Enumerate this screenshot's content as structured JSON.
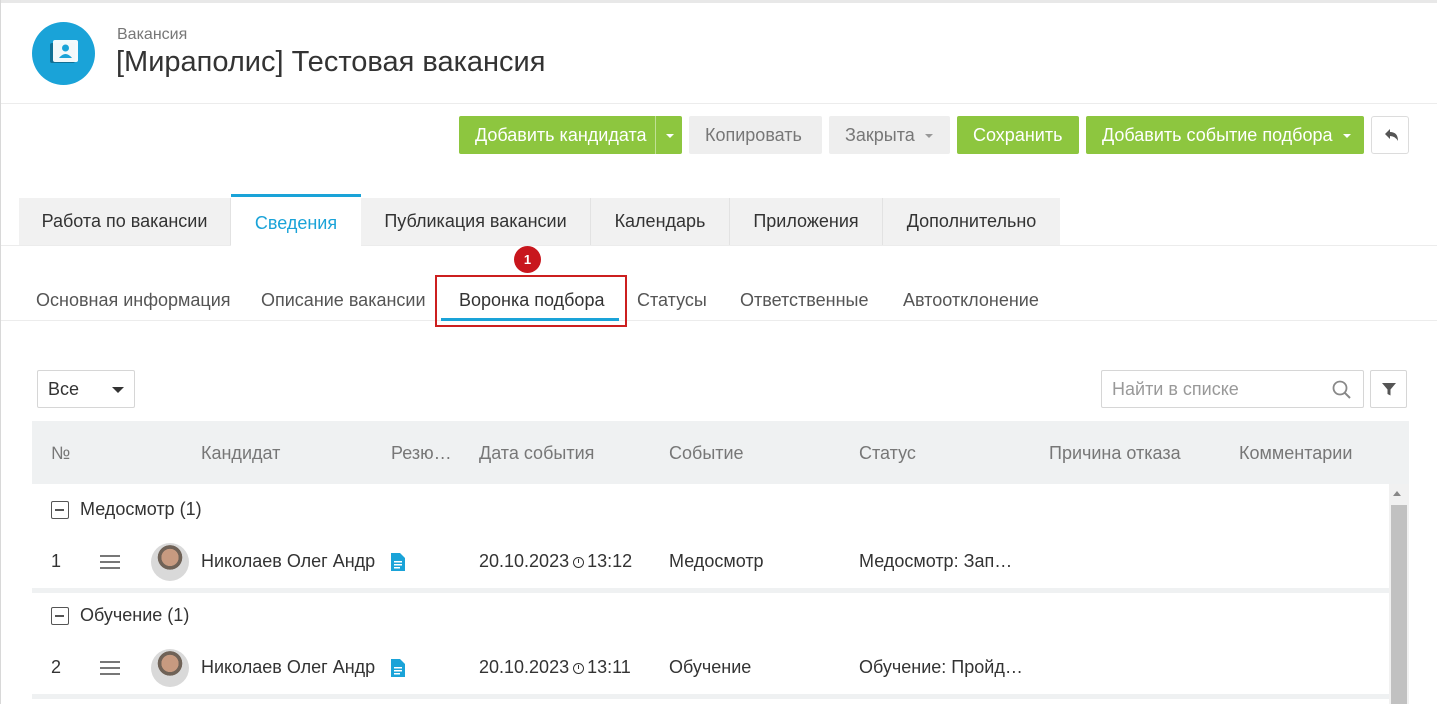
{
  "header": {
    "subtitle": "Вакансия",
    "title": "[Мираполис] Тестовая вакансия"
  },
  "toolbar": {
    "add_candidate": "Добавить кандидата",
    "copy": "Копировать",
    "status": "Закрыта",
    "save": "Сохранить",
    "add_event": "Добавить событие подбора"
  },
  "main_tabs": [
    {
      "label": "Работа по вакансии"
    },
    {
      "label": "Сведения"
    },
    {
      "label": "Публикация вакансии"
    },
    {
      "label": "Календарь"
    },
    {
      "label": "Приложения"
    },
    {
      "label": "Дополнительно"
    }
  ],
  "sub_tabs": [
    {
      "label": "Основная информация"
    },
    {
      "label": "Описание вакансии"
    },
    {
      "label": "Воронка подбора"
    },
    {
      "label": "Статусы"
    },
    {
      "label": "Ответственные"
    },
    {
      "label": "Автоотклонение"
    }
  ],
  "annotation": {
    "marker": "1"
  },
  "filter": {
    "selected": "Все",
    "search_placeholder": "Найти в списке"
  },
  "table": {
    "columns": [
      "№",
      "Кандидат",
      "Резю…",
      "Дата события",
      "Событие",
      "Статус",
      "Причина отказа",
      "Комментарии"
    ],
    "groups": [
      {
        "label": "Медосмотр (1)",
        "rows": [
          {
            "num": "1",
            "candidate": "Николаев Олег Андр",
            "date": "20.10.2023",
            "time": "13:12",
            "event": "Медосмотр",
            "status": "Медосмотр: Зап…"
          }
        ]
      },
      {
        "label": "Обучение (1)",
        "rows": [
          {
            "num": "2",
            "candidate": "Николаев Олег Андр",
            "date": "20.10.2023",
            "time": "13:11",
            "event": "Обучение",
            "status": "Обучение: Пройд…"
          }
        ]
      }
    ]
  },
  "colors": {
    "accent": "#1aa3d8",
    "green": "#8dc63f",
    "marker": "#c8161d"
  }
}
